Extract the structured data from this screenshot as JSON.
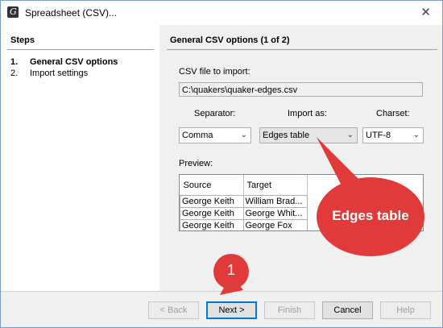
{
  "window": {
    "title": "Spreadsheet (CSV)...",
    "close_glyph": "✕",
    "app_icon_glyph": "G"
  },
  "steps": {
    "heading": "Steps",
    "items": [
      {
        "number": "1.",
        "label": "General CSV options",
        "active": true
      },
      {
        "number": "2.",
        "label": "Import settings",
        "active": false
      }
    ]
  },
  "panel": {
    "heading": "General CSV options (1 of 2)",
    "file_label": "CSV file to import:",
    "file_value": "C:\\quakers\\quaker-edges.csv",
    "separator_label": "Separator:",
    "separator_value": "Comma",
    "import_as_label": "Import as:",
    "import_as_value": "Edges table",
    "charset_label": "Charset:",
    "charset_value": "UTF-8",
    "preview_label": "Preview:",
    "preview": {
      "columns": [
        "Source",
        "Target"
      ],
      "rows": [
        [
          "George Keith",
          "William Brad..."
        ],
        [
          "George Keith",
          "George Whit..."
        ],
        [
          "George Keith",
          "George Fox"
        ]
      ]
    }
  },
  "buttons": {
    "back": "< Back",
    "next": "Next >",
    "finish": "Finish",
    "cancel": "Cancel",
    "help": "Help"
  },
  "annotations": {
    "callout_text": "Edges table",
    "badge_number": "1",
    "color": "#e03a3a"
  },
  "icons": {
    "dropdown": "chevron-down-icon",
    "close": "close-icon"
  }
}
